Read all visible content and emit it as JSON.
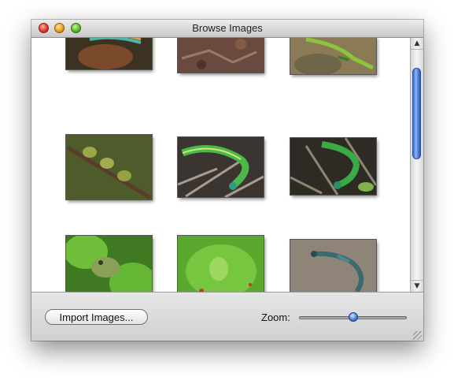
{
  "window": {
    "title": "Browse Images"
  },
  "titlebar": {
    "buttons": [
      {
        "icon": "close-button-icon"
      },
      {
        "icon": "minimize-button-icon"
      },
      {
        "icon": "zoom-button-icon"
      }
    ]
  },
  "toolbar": {
    "import_label": "Import Images...",
    "zoom_label": "Zoom:",
    "zoom_value": 0.5
  },
  "scrollbar": {
    "up_icon": "scroll-up-arrow-icon",
    "down_icon": "scroll-down-arrow-icon"
  },
  "images": [
    {
      "name": "lizard-on-rock-photo"
    },
    {
      "name": "ground-leaves-photo"
    },
    {
      "name": "green-lizard-on-rock-photo"
    },
    {
      "name": "tree-frogs-on-branch-photo"
    },
    {
      "name": "green-lizard-on-twigs-photo"
    },
    {
      "name": "green-lizard-in-leaves-photo"
    },
    {
      "name": "frog-on-leaf-photo"
    },
    {
      "name": "green-frog-on-leaf-photo"
    },
    {
      "name": "blue-lizard-on-sand-photo"
    }
  ]
}
